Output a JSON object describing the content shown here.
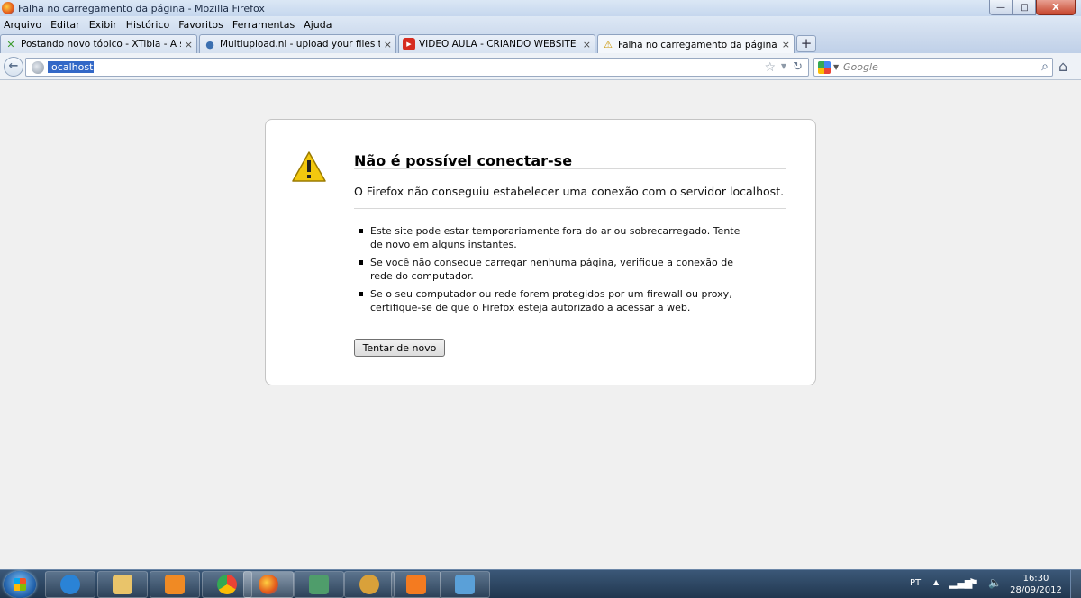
{
  "window": {
    "title": "Falha no carregamento da página - Mozilla Firefox",
    "buttons": {
      "minimize": "—",
      "maximize": "□",
      "close": "X"
    }
  },
  "menu": [
    "Arquivo",
    "Editar",
    "Exibir",
    "Histórico",
    "Favoritos",
    "Ferramentas",
    "Ajuda"
  ],
  "tabs": [
    {
      "label": "Postando novo tópico - XTibia - A su...",
      "icon": "xtibia-icon",
      "color": "#3a9a2c",
      "active": false
    },
    {
      "label": "Multiupload.nl - upload your files to ...",
      "icon": "multiupload-icon",
      "color": "#3b6fb0",
      "active": false
    },
    {
      "label": "VIDEO AULA - CRIANDO WEBSITE CO...",
      "icon": "youtube-icon",
      "color": "#d62b20",
      "active": false
    },
    {
      "label": "Falha no carregamento da página",
      "icon": "warning-icon",
      "color": "#e0a800",
      "active": true
    }
  ],
  "navbar": {
    "url": "localhost",
    "search_placeholder": "Google"
  },
  "error": {
    "title": "Não é possível conectar-se",
    "description": "O Firefox não conseguiu estabelecer uma conexão com o servidor localhost.",
    "items": [
      "Este site pode estar temporariamente fora do ar ou sobrecarregado. Tente de novo em alguns instantes.",
      "Se você não conseque carregar nenhuma página, verifique a conexão de rede do computador.",
      "Se o seu computador ou rede forem protegidos por um firewall ou proxy, certifique-se de que o Firefox esteja autorizado a acessar a web."
    ],
    "retry_label": "Tentar de novo"
  },
  "taskbar": {
    "apps": [
      {
        "name": "internet-explorer-icon",
        "color": "#2a83d6"
      },
      {
        "name": "file-explorer-icon",
        "color": "#e9c46a"
      },
      {
        "name": "media-player-icon",
        "color": "#f08a24"
      },
      {
        "name": "chrome-icon",
        "color": "#3aa757"
      },
      {
        "name": "firefox-icon",
        "color": "#e2561a"
      },
      {
        "name": "monitor-app-icon",
        "color": "#4f9d6b"
      },
      {
        "name": "user-avatar-app-icon",
        "color": "#d9a13a"
      },
      {
        "name": "xampp-icon",
        "color": "#f47b20"
      },
      {
        "name": "paint-icon",
        "color": "#5aa0d8"
      }
    ],
    "language": "PT",
    "time": "16:30",
    "date": "28/09/2012"
  },
  "colors": {
    "selection": "#3368c7",
    "warning_yellow": "#f2c80f"
  }
}
